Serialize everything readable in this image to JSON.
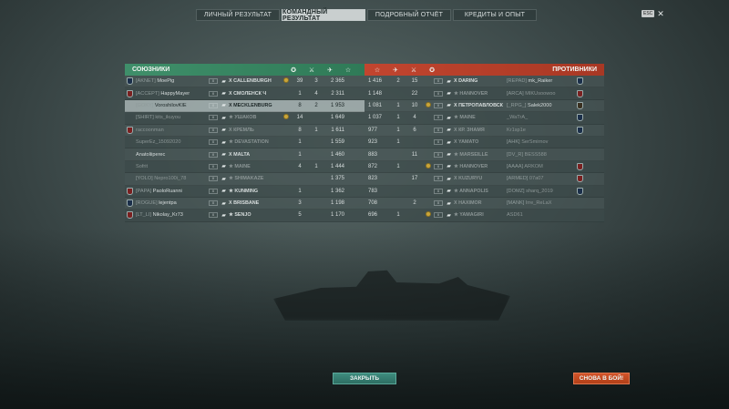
{
  "tabs": [
    {
      "label": "ЛИЧНЫЙ РЕЗУЛЬТАТ",
      "active": false
    },
    {
      "label": "КОМАНДНЫЙ РЕЗУЛЬТАТ",
      "active": true
    },
    {
      "label": "ПОДРОБНЫЙ ОТЧЁТ",
      "active": false
    },
    {
      "label": "КРЕДИТЫ И ОПЫТ",
      "active": false
    }
  ],
  "esc": {
    "key": "ESC",
    "close": "✕"
  },
  "allies": {
    "title": "СОЮЗНИКИ",
    "rows": [
      {
        "clan": "[AKNET]",
        "name": "MoePig",
        "tier": "X",
        "ship": "X  CALLENBURGH",
        "medal": true,
        "frags": "",
        "kills": "39",
        "planes": "3",
        "xp": "2 365",
        "dead": false,
        "self": false,
        "emblem": "#1b2f4a"
      },
      {
        "clan": "[ACCEPT]",
        "name": "HappyMayer",
        "tier": "X",
        "ship": "X  СМОЛЕНСК Ч",
        "medal": false,
        "frags": "",
        "kills": "1",
        "planes": "4",
        "xp": "2 311",
        "dead": false,
        "self": false,
        "emblem": "#7a2020"
      },
      {
        "clan": "[GOKY]",
        "name": "VoroshilovKIE",
        "tier": "X",
        "ship": "X  MECKLENBURG",
        "medal": false,
        "frags": "",
        "kills": "8",
        "planes": "2",
        "xp": "1 953",
        "dead": false,
        "self": true,
        "emblem": ""
      },
      {
        "clan": "[SHIRT]",
        "name": "kits_ikuyou",
        "tier": "X",
        "ship": "★  УШАКОВ",
        "medal": true,
        "frags": "",
        "kills": "14",
        "planes": "",
        "xp": "1 649",
        "dead": true,
        "self": false,
        "emblem": ""
      },
      {
        "clan": "",
        "name": "raccoonman",
        "tier": "X",
        "ship": "X  КРЕМЛЬ",
        "medal": false,
        "frags": "",
        "kills": "8",
        "planes": "1",
        "xp": "1 611",
        "dead": true,
        "self": false,
        "emblem": "#7a2020"
      },
      {
        "clan": "",
        "name": "SuperEz_15092020",
        "tier": "X",
        "ship": "★  DEVASTATION",
        "medal": false,
        "frags": "",
        "kills": "1",
        "planes": "",
        "xp": "1 559",
        "dead": true,
        "self": false,
        "emblem": ""
      },
      {
        "clan": "",
        "name": "Anatoliiperec",
        "tier": "X",
        "ship": "X  MALTA",
        "medal": false,
        "frags": "",
        "kills": "1",
        "planes": "",
        "xp": "1 460",
        "dead": false,
        "self": false,
        "emblem": ""
      },
      {
        "clan": "",
        "name": "Sofrit",
        "tier": "X",
        "ship": "★  MAINE",
        "medal": false,
        "frags": "",
        "kills": "4",
        "planes": "1",
        "xp": "1 444",
        "dead": true,
        "self": false,
        "emblem": ""
      },
      {
        "clan": "[YOLO]",
        "name": "Nepro100i_78",
        "tier": "X",
        "ship": "★  SHIMAKAZE",
        "medal": false,
        "frags": "",
        "kills": "",
        "planes": "",
        "xp": "1 375",
        "dead": true,
        "self": false,
        "emblem": ""
      },
      {
        "clan": "[PAPA]",
        "name": "PaoloRuanni",
        "tier": "X",
        "ship": "★  KUNMING",
        "medal": false,
        "frags": "",
        "kills": "1",
        "planes": "",
        "xp": "1 362",
        "dead": false,
        "self": false,
        "emblem": "#7a2020"
      },
      {
        "clan": "[ROGUE]",
        "name": "lejentpa",
        "tier": "X",
        "ship": "X  BRISBANE",
        "medal": false,
        "frags": "",
        "kills": "3",
        "planes": "",
        "xp": "1 198",
        "dead": false,
        "self": false,
        "emblem": "#1b2f4a"
      },
      {
        "clan": "[LT_LI]",
        "name": "Nikolay_Kr73",
        "tier": "X",
        "ship": "★  SENJŌ",
        "medal": false,
        "frags": "",
        "kills": "5",
        "planes": "",
        "xp": "1 170",
        "dead": false,
        "self": false,
        "emblem": "#7a2020"
      }
    ]
  },
  "enemies": {
    "title": "ПРОТИВНИКИ",
    "rows": [
      {
        "xp": "1 416",
        "planes": "2",
        "kills": "15",
        "medal": false,
        "tier": "X",
        "ship": "X  DARING",
        "clan": "[REPAD]",
        "name": "mk_Raiker",
        "dead": false,
        "emblem": "#1b2f4a"
      },
      {
        "xp": "1 148",
        "planes": "",
        "kills": "22",
        "medal": false,
        "tier": "X",
        "ship": "★  HANNOVER",
        "clan": "[ARCA]",
        "name": "MIKUsoowoo",
        "dead": true,
        "emblem": "#7a2020"
      },
      {
        "xp": "1 081",
        "planes": "1",
        "kills": "10",
        "medal": true,
        "tier": "X",
        "ship": "X  ПЕТРОПАВЛОВСК",
        "clan": "[_RPG_]",
        "name": "Salek2000",
        "dead": false,
        "emblem": "#3a3020"
      },
      {
        "xp": "1 037",
        "planes": "1",
        "kills": "4",
        "medal": false,
        "tier": "X",
        "ship": "★  MAINE",
        "clan": "",
        "name": "_WaTrA_",
        "dead": true,
        "emblem": "#1b2f4a"
      },
      {
        "xp": "977",
        "planes": "1",
        "kills": "6",
        "medal": false,
        "tier": "X",
        "ship": "X  КР. ЗНАМЯ",
        "clan": "",
        "name": "Kr1sp1e",
        "dead": true,
        "emblem": "#1b2f4a"
      },
      {
        "xp": "923",
        "planes": "1",
        "kills": "",
        "medal": false,
        "tier": "X",
        "ship": "X  YAMATO",
        "clan": "[AHK]",
        "name": "SerSmirnov",
        "dead": true,
        "emblem": ""
      },
      {
        "xp": "883",
        "planes": "",
        "kills": "11",
        "medal": false,
        "tier": "X",
        "ship": "★  MARSEILLE",
        "clan": "[DV_R]",
        "name": "BESS588",
        "dead": true,
        "emblem": ""
      },
      {
        "xp": "872",
        "planes": "1",
        "kills": "",
        "medal": true,
        "tier": "X",
        "ship": "★  HANNOVER",
        "clan": "[AAAA]",
        "name": "ARKOM",
        "dead": true,
        "emblem": "#7a2020"
      },
      {
        "xp": "823",
        "planes": "",
        "kills": "17",
        "medal": false,
        "tier": "X",
        "ship": "X  KUZURYŪ",
        "clan": "[ARMED]",
        "name": "07a07",
        "dead": true,
        "emblem": "#7a2020"
      },
      {
        "xp": "783",
        "planes": "",
        "kills": "",
        "medal": false,
        "tier": "X",
        "ship": "★  ANNAPOLIS",
        "clan": "[DOMZ]",
        "name": "sharq_2019",
        "dead": true,
        "emblem": "#1b2f4a"
      },
      {
        "xp": "708",
        "planes": "",
        "kills": "2",
        "medal": false,
        "tier": "X",
        "ship": "X  HAXIMOR",
        "clan": "[MANK]",
        "name": "Irre_ReLaX",
        "dead": true,
        "emblem": ""
      },
      {
        "xp": "696",
        "planes": "1",
        "kills": "",
        "medal": true,
        "tier": "X",
        "ship": "★  YAMAGIRI",
        "clan": "",
        "name": "ASD61",
        "dead": true,
        "emblem": ""
      }
    ]
  },
  "header_icons": {
    "medal": "medal-icon",
    "kills": "crossed-swords-icon",
    "planes": "plane-icon",
    "xp": "star-icon"
  },
  "buttons": {
    "close": "ЗАКРЫТЬ",
    "battle": "СНОВА В БОЙ!"
  },
  "colors": {
    "allies": "#3f8f6a",
    "enemies": "#c2452f",
    "close": "#3e8c7e",
    "battle": "#d2542a"
  }
}
